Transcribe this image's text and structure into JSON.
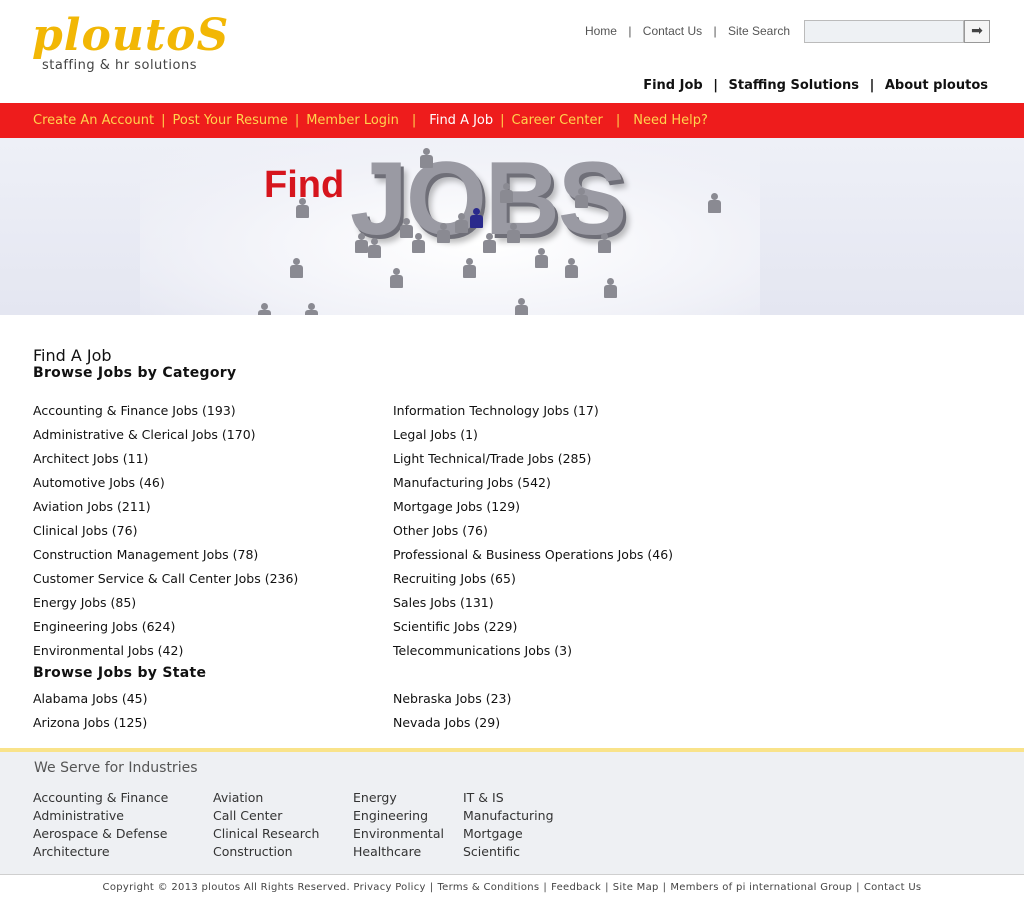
{
  "brand": {
    "name": "ploutoS",
    "tagline": "staffing & hr solutions"
  },
  "top_nav": {
    "home": "Home",
    "contact": "Contact Us",
    "site_search": "Site Search",
    "search_placeholder": "",
    "separator": "|"
  },
  "main_nav": {
    "items": [
      "Find Job",
      "Staffing Solutions",
      "About ploutos"
    ],
    "separator": "|"
  },
  "red_nav": {
    "items": [
      "Create An Account",
      "Post Your Resume",
      "Member Login",
      "Find A Job",
      "Career Center",
      "Need Help?"
    ],
    "active_index": 3,
    "separator": "|"
  },
  "banner": {
    "find_word": "Find",
    "jobs_word": "JOBS"
  },
  "content": {
    "page_title": "Find A Job",
    "category_heading": "Browse Jobs by Category",
    "state_heading": "Browse Jobs by State",
    "categories_left": [
      "Accounting & Finance Jobs (193)",
      "Administrative & Clerical Jobs (170)",
      "Architect Jobs (11)",
      "Automotive Jobs (46)",
      "Aviation Jobs (211)",
      "Clinical Jobs (76)",
      "Construction Management Jobs (78)",
      "Customer Service & Call Center Jobs (236)",
      "Energy Jobs (85)",
      "Engineering Jobs (624)",
      "Environmental Jobs (42)"
    ],
    "categories_right": [
      "Information Technology Jobs (17)",
      "Legal Jobs (1)",
      "Light Technical/Trade Jobs (285)",
      "Manufacturing Jobs (542)",
      "Mortgage Jobs (129)",
      "Other Jobs (76)",
      "Professional & Business Operations Jobs (46)",
      "Recruiting Jobs (65)",
      "Sales Jobs (131)",
      "Scientific Jobs (229)",
      "Telecommunications Jobs (3)"
    ],
    "states_left": [
      "Alabama Jobs (45)",
      "Arizona Jobs (125)"
    ],
    "states_right": [
      "Nebraska Jobs (23)",
      "Nevada Jobs (29)"
    ]
  },
  "footer": {
    "industries_title": "We Serve for Industries",
    "columns": [
      [
        "Accounting & Finance",
        "Administrative",
        "Aerospace & Defense",
        "Architecture"
      ],
      [
        "Aviation",
        "Call Center",
        "Clinical Research",
        "Construction"
      ],
      [
        "Energy",
        "Engineering",
        "Environmental",
        "Healthcare"
      ],
      [
        "IT & IS",
        "Manufacturing",
        "Mortgage",
        "Scientific"
      ]
    ],
    "copyright": "Copyright © 2013 ploutos All Rights Reserved.",
    "links": [
      "Privacy Policy",
      "Terms & Conditions",
      "Feedback",
      "Site Map",
      "Members of pi international Group",
      "Contact Us"
    ],
    "separator": "|"
  },
  "colors": {
    "red_nav": "#ee1c1c",
    "nav_text": "#ffd34d",
    "brand_yellow": "#f2b705",
    "footer_bg": "#eef0f3"
  },
  "icons": {
    "search_submit": "arrow-right-icon"
  }
}
